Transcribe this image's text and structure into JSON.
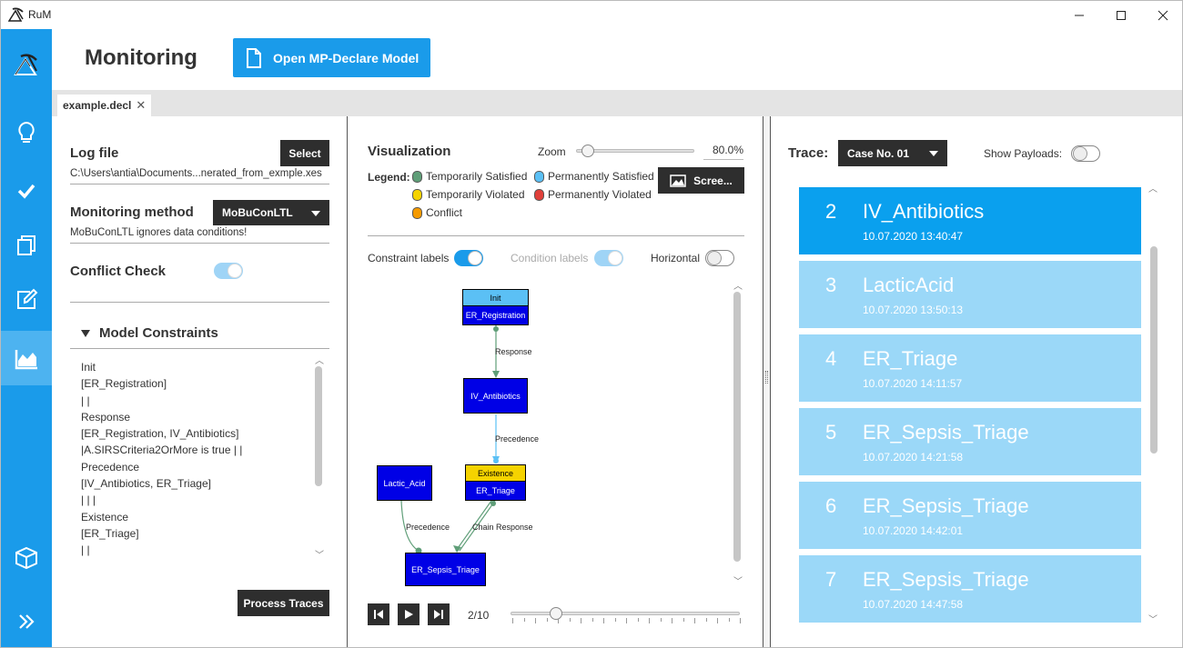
{
  "window": {
    "title": "RuM"
  },
  "sidebar": {
    "items": [
      {
        "icon": "logo-icon"
      },
      {
        "icon": "lightbulb-icon"
      },
      {
        "icon": "checkmark-icon"
      },
      {
        "icon": "copy-icon"
      },
      {
        "icon": "edit-icon"
      },
      {
        "icon": "monitoring-chart-icon",
        "active": true
      },
      {
        "icon": "cube-icon"
      },
      {
        "icon": "expand-chevrons-icon"
      }
    ]
  },
  "header": {
    "title": "Monitoring",
    "open_button": "Open MP-Declare Model"
  },
  "tabs": [
    {
      "label": "example.decl",
      "close": "✕"
    }
  ],
  "left": {
    "log_file_label": "Log file",
    "select_button": "Select",
    "log_path": "C:\\Users\\antia\\Documents...nerated_from_exmple.xes",
    "method_label": "Monitoring method",
    "method_value": "MoBuConLTL",
    "method_note": "MoBuConLTL ignores data conditions!",
    "conflict_label": "Conflict Check",
    "model_constraints_label": "Model Constraints",
    "constraints": [
      "Init",
      "[ER_Registration]",
      "| |",
      "Response",
      "[ER_Registration, IV_Antibiotics]",
      "|A.SIRSCriteria2OrMore is true | |",
      "Precedence",
      "[IV_Antibiotics, ER_Triage]",
      "| | |",
      "Existence",
      "[ER_Triage]",
      "| |"
    ],
    "process_button": "Process Traces"
  },
  "middle": {
    "visualization_label": "Visualization",
    "zoom_label": "Zoom",
    "zoom_value": "80.0%",
    "zoom_fraction": 0.1,
    "legend_label": "Legend:",
    "legend": [
      {
        "label": "Temporarily Satisfied",
        "color": "#5f9e78"
      },
      {
        "label": "Permanently Satisfied",
        "color": "#5bc0f5"
      },
      {
        "label": "Temporarily Violated",
        "color": "#f5d300"
      },
      {
        "label": "Permanently Violated",
        "color": "#e0403a"
      },
      {
        "label": "Conflict",
        "color": "#f59a00"
      }
    ],
    "screenshot_button": "Scree...",
    "constraint_labels": "Constraint labels",
    "condition_labels": "Condition labels",
    "horizontal_label": "Horizontal",
    "graph": {
      "nodes": {
        "er_registration": {
          "head": "Init",
          "label": "ER_Registration"
        },
        "iv_antibiotics": {
          "label": "IV_Antibiotics"
        },
        "er_triage": {
          "head": "Existence",
          "label": "ER_Triage"
        },
        "lactic_acid": {
          "label": "Lactic_Acid"
        },
        "er_sepsis_triage": {
          "label": "ER_Sepsis_Triage"
        }
      },
      "edges": {
        "response": "Response",
        "precedence_1": "Precedence",
        "precedence_2": "Precedence",
        "chain_response": "Chain Response"
      }
    },
    "step_label": "2/10",
    "step_fraction": 0.2
  },
  "right": {
    "trace_label": "Trace:",
    "trace_value": "Case No. 01",
    "show_payloads": "Show Payloads:",
    "events": [
      {
        "num": "2",
        "name": "IV_Antibiotics",
        "ts": "10.07.2020 13:40:47",
        "selected": true
      },
      {
        "num": "3",
        "name": "LacticAcid",
        "ts": "10.07.2020 13:50:13"
      },
      {
        "num": "4",
        "name": "ER_Triage",
        "ts": "10.07.2020 14:11:57"
      },
      {
        "num": "5",
        "name": "ER_Sepsis_Triage",
        "ts": "10.07.2020 14:21:58"
      },
      {
        "num": "6",
        "name": "ER_Sepsis_Triage",
        "ts": "10.07.2020 14:42:01"
      },
      {
        "num": "7",
        "name": "ER_Sepsis_Triage",
        "ts": "10.07.2020 14:47:58"
      }
    ]
  }
}
